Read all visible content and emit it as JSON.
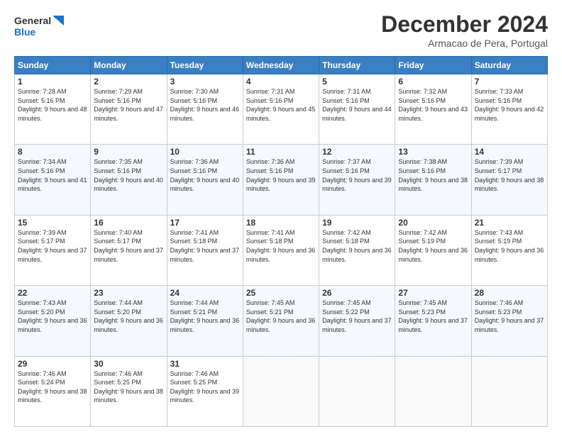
{
  "header": {
    "logo_line1": "General",
    "logo_line2": "Blue",
    "month": "December 2024",
    "location": "Armacao de Pera, Portugal"
  },
  "weekdays": [
    "Sunday",
    "Monday",
    "Tuesday",
    "Wednesday",
    "Thursday",
    "Friday",
    "Saturday"
  ],
  "weeks": [
    [
      {
        "day": "1",
        "sunrise": "7:28 AM",
        "sunset": "5:16 PM",
        "daylight": "9 hours and 48 minutes."
      },
      {
        "day": "2",
        "sunrise": "7:29 AM",
        "sunset": "5:16 PM",
        "daylight": "9 hours and 47 minutes."
      },
      {
        "day": "3",
        "sunrise": "7:30 AM",
        "sunset": "5:16 PM",
        "daylight": "9 hours and 46 minutes."
      },
      {
        "day": "4",
        "sunrise": "7:31 AM",
        "sunset": "5:16 PM",
        "daylight": "9 hours and 45 minutes."
      },
      {
        "day": "5",
        "sunrise": "7:31 AM",
        "sunset": "5:16 PM",
        "daylight": "9 hours and 44 minutes."
      },
      {
        "day": "6",
        "sunrise": "7:32 AM",
        "sunset": "5:16 PM",
        "daylight": "9 hours and 43 minutes."
      },
      {
        "day": "7",
        "sunrise": "7:33 AM",
        "sunset": "5:16 PM",
        "daylight": "9 hours and 42 minutes."
      }
    ],
    [
      {
        "day": "8",
        "sunrise": "7:34 AM",
        "sunset": "5:16 PM",
        "daylight": "9 hours and 41 minutes."
      },
      {
        "day": "9",
        "sunrise": "7:35 AM",
        "sunset": "5:16 PM",
        "daylight": "9 hours and 40 minutes."
      },
      {
        "day": "10",
        "sunrise": "7:36 AM",
        "sunset": "5:16 PM",
        "daylight": "9 hours and 40 minutes."
      },
      {
        "day": "11",
        "sunrise": "7:36 AM",
        "sunset": "5:16 PM",
        "daylight": "9 hours and 39 minutes."
      },
      {
        "day": "12",
        "sunrise": "7:37 AM",
        "sunset": "5:16 PM",
        "daylight": "9 hours and 39 minutes."
      },
      {
        "day": "13",
        "sunrise": "7:38 AM",
        "sunset": "5:16 PM",
        "daylight": "9 hours and 38 minutes."
      },
      {
        "day": "14",
        "sunrise": "7:39 AM",
        "sunset": "5:17 PM",
        "daylight": "9 hours and 38 minutes."
      }
    ],
    [
      {
        "day": "15",
        "sunrise": "7:39 AM",
        "sunset": "5:17 PM",
        "daylight": "9 hours and 37 minutes."
      },
      {
        "day": "16",
        "sunrise": "7:40 AM",
        "sunset": "5:17 PM",
        "daylight": "9 hours and 37 minutes."
      },
      {
        "day": "17",
        "sunrise": "7:41 AM",
        "sunset": "5:18 PM",
        "daylight": "9 hours and 37 minutes."
      },
      {
        "day": "18",
        "sunrise": "7:41 AM",
        "sunset": "5:18 PM",
        "daylight": "9 hours and 36 minutes."
      },
      {
        "day": "19",
        "sunrise": "7:42 AM",
        "sunset": "5:18 PM",
        "daylight": "9 hours and 36 minutes."
      },
      {
        "day": "20",
        "sunrise": "7:42 AM",
        "sunset": "5:19 PM",
        "daylight": "9 hours and 36 minutes."
      },
      {
        "day": "21",
        "sunrise": "7:43 AM",
        "sunset": "5:19 PM",
        "daylight": "9 hours and 36 minutes."
      }
    ],
    [
      {
        "day": "22",
        "sunrise": "7:43 AM",
        "sunset": "5:20 PM",
        "daylight": "9 hours and 36 minutes."
      },
      {
        "day": "23",
        "sunrise": "7:44 AM",
        "sunset": "5:20 PM",
        "daylight": "9 hours and 36 minutes."
      },
      {
        "day": "24",
        "sunrise": "7:44 AM",
        "sunset": "5:21 PM",
        "daylight": "9 hours and 36 minutes."
      },
      {
        "day": "25",
        "sunrise": "7:45 AM",
        "sunset": "5:21 PM",
        "daylight": "9 hours and 36 minutes."
      },
      {
        "day": "26",
        "sunrise": "7:45 AM",
        "sunset": "5:22 PM",
        "daylight": "9 hours and 37 minutes."
      },
      {
        "day": "27",
        "sunrise": "7:45 AM",
        "sunset": "5:23 PM",
        "daylight": "9 hours and 37 minutes."
      },
      {
        "day": "28",
        "sunrise": "7:46 AM",
        "sunset": "5:23 PM",
        "daylight": "9 hours and 37 minutes."
      }
    ],
    [
      {
        "day": "29",
        "sunrise": "7:46 AM",
        "sunset": "5:24 PM",
        "daylight": "9 hours and 38 minutes."
      },
      {
        "day": "30",
        "sunrise": "7:46 AM",
        "sunset": "5:25 PM",
        "daylight": "9 hours and 38 minutes."
      },
      {
        "day": "31",
        "sunrise": "7:46 AM",
        "sunset": "5:25 PM",
        "daylight": "9 hours and 39 minutes."
      },
      null,
      null,
      null,
      null
    ]
  ]
}
